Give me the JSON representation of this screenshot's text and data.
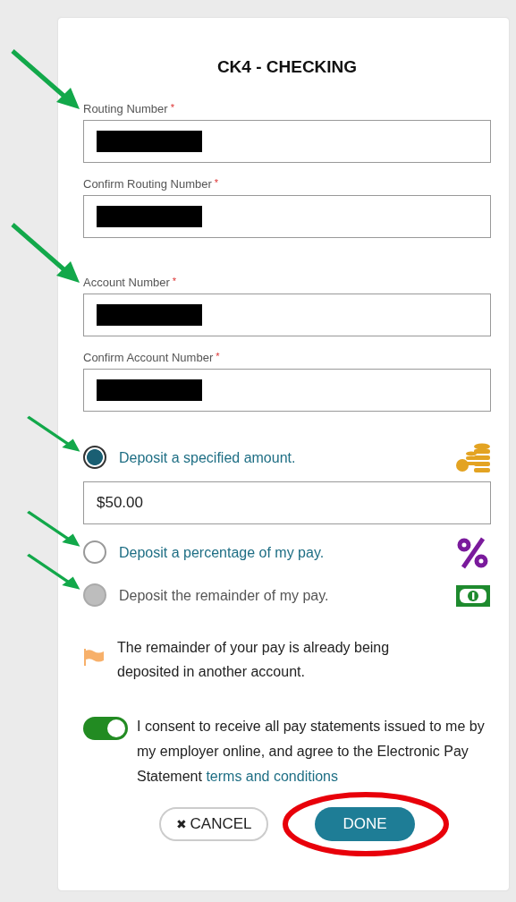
{
  "title": "CK4 - CHECKING",
  "fields": [
    {
      "label": "Routing Number",
      "required_mark": "*",
      "redacted": true,
      "arrow": true
    },
    {
      "label": "Confirm Routing Number",
      "required_mark": "*",
      "redacted": true
    },
    {
      "label": "Account Number",
      "required_mark": "*",
      "redacted": true,
      "arrow": true
    },
    {
      "label": "Confirm Account Number",
      "required_mark": "*",
      "redacted": true
    }
  ],
  "options": [
    {
      "label": "Deposit a specified amount.",
      "selected": true,
      "disabled": false,
      "arrow": true,
      "amount": "$50.00"
    },
    {
      "label": "Deposit a percentage of my pay.",
      "selected": false,
      "disabled": false,
      "arrow": true
    },
    {
      "label": "Deposit the remainder of my pay.",
      "selected": false,
      "disabled": true,
      "arrow": true
    }
  ],
  "notice": "The remainder of your pay is already being deposited in another account.",
  "consent": {
    "on": true,
    "text": "I consent to receive all pay statements issued to me by my employer online, and agree to the Electronic Pay Statement",
    "link": "terms and conditions"
  },
  "buttons": [
    {
      "kind": "cancel",
      "icon": "✖",
      "label": "CANCEL",
      "circled": false
    },
    {
      "kind": "done",
      "label": "DONE",
      "circled": true
    }
  ]
}
